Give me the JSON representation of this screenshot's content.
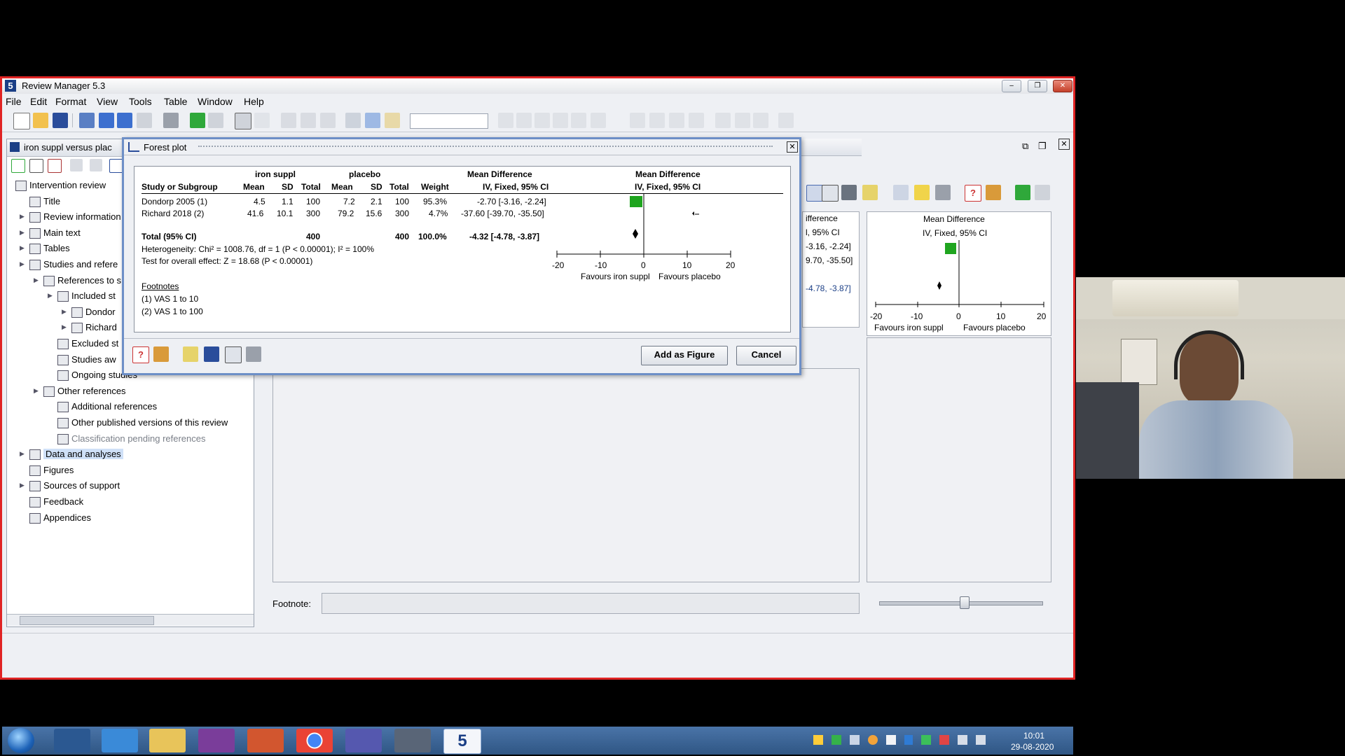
{
  "window": {
    "title": "Review Manager 5.3",
    "app_icon": "5"
  },
  "menu": [
    "File",
    "Edit",
    "Format",
    "View",
    "Tools",
    "Table",
    "Window",
    "Help"
  ],
  "left_panel": {
    "tab_title": "iron suppl versus plac",
    "tree": [
      {
        "label": "Intervention review",
        "level": 0,
        "icon": "review-icon"
      },
      {
        "label": "Title",
        "level": 1,
        "icon": "title-icon"
      },
      {
        "label": "Review information",
        "level": 1,
        "icon": "info-icon",
        "expandable": true
      },
      {
        "label": "Main text",
        "level": 1,
        "icon": "text-icon",
        "expandable": true
      },
      {
        "label": "Tables",
        "level": 1,
        "icon": "table-icon",
        "expandable": true
      },
      {
        "label": "Studies and refere",
        "level": 1,
        "icon": "studies-icon",
        "expandable": true
      },
      {
        "label": "References to s",
        "level": 2,
        "icon": "refs-icon",
        "expandable": true
      },
      {
        "label": "Included st",
        "level": 3,
        "icon": "study-icon",
        "expandable": true
      },
      {
        "label": "Dondor",
        "level": 4,
        "icon": "study-icon",
        "expandable": true
      },
      {
        "label": "Richard",
        "level": 4,
        "icon": "study-icon",
        "expandable": true
      },
      {
        "label": "Excluded st",
        "level": 3,
        "icon": "study-icon"
      },
      {
        "label": "Studies aw",
        "level": 3,
        "icon": "study-icon"
      },
      {
        "label": "Ongoing studies",
        "level": 3,
        "icon": "study-icon"
      },
      {
        "label": "Other references",
        "level": 2,
        "icon": "refs-icon",
        "expandable": true
      },
      {
        "label": "Additional references",
        "level": 3,
        "icon": "refs-icon"
      },
      {
        "label": "Other published versions of this review",
        "level": 3,
        "icon": "refs-icon"
      },
      {
        "label": "Classification pending references",
        "level": 3,
        "icon": "refs-icon",
        "dim": true
      },
      {
        "label": "Data and analyses",
        "level": 1,
        "icon": "analysis-icon",
        "expandable": true,
        "selected": true
      },
      {
        "label": "Figures",
        "level": 1,
        "icon": "figure-icon"
      },
      {
        "label": "Sources of support",
        "level": 1,
        "icon": "support-icon",
        "expandable": true
      },
      {
        "label": "Feedback",
        "level": 1,
        "icon": "feedback-icon"
      },
      {
        "label": "Appendices",
        "level": 1,
        "icon": "appendix-icon"
      }
    ]
  },
  "right_panel": {
    "col_header_partial": "ifference",
    "col_sub_partial": "l, 95% CI",
    "row1_partial": "-3.16, -2.24]",
    "row2_partial": "9.70, -35.50]",
    "total_partial": "-4.78, -3.87]",
    "md_header": "Mean Difference",
    "md_sub": "IV, Fixed, 95% CI",
    "axis_ticks": [
      "-20",
      "-10",
      "0",
      "10",
      "20"
    ],
    "favours_left": "Favours iron suppl",
    "favours_right": "Favours placebo"
  },
  "footnote_label": "Footnote:",
  "dialog": {
    "title": "Forest plot",
    "group_exp": "iron suppl",
    "group_ctrl": "placebo",
    "md_header": "Mean Difference",
    "md_sub": "IV, Fixed, 95% CI",
    "col_study": "Study or Subgroup",
    "col_mean": "Mean",
    "col_sd": "SD",
    "col_total": "Total",
    "col_weight": "Weight",
    "rows": [
      {
        "study": "Dondorp 2005 (1)",
        "m1": "4.5",
        "sd1": "1.1",
        "n1": "100",
        "m2": "7.2",
        "sd2": "2.1",
        "n2": "100",
        "w": "95.3%",
        "ci": "-2.70 [-3.16, -2.24]"
      },
      {
        "study": "Richard 2018 (2)",
        "m1": "41.6",
        "sd1": "10.1",
        "n1": "300",
        "m2": "79.2",
        "sd2": "15.6",
        "n2": "300",
        "w": "4.7%",
        "ci": "-37.60 [-39.70, -35.50]"
      }
    ],
    "total": {
      "label": "Total (95% CI)",
      "n1": "400",
      "n2": "400",
      "w": "100.0%",
      "ci": "-4.32 [-4.78, -3.87]"
    },
    "heterogeneity": "Heterogeneity: Chi² = 1008.76, df = 1 (P < 0.00001); I² = 100%",
    "overall": "Test for overall effect: Z = 18.68 (P < 0.00001)",
    "footnotes_title": "Footnotes",
    "footnotes": [
      "(1) VAS 1 to 10",
      "(2) VAS 1 to 100"
    ],
    "axis_ticks": [
      "-20",
      "-10",
      "0",
      "10",
      "20"
    ],
    "favours_left": "Favours iron suppl",
    "favours_right": "Favours placebo",
    "add_button": "Add as Figure",
    "cancel_button": "Cancel"
  },
  "taskbar": {
    "time": "10:01",
    "date": "29-08-2020",
    "apps": [
      "windows-start",
      "task-manager",
      "internet-explorer",
      "file-explorer",
      "onenote",
      "powerpoint",
      "chrome",
      "teams",
      "review-tool",
      "review-manager"
    ]
  },
  "colors": {
    "accent_border": "#e02424",
    "square": "#1fa51f",
    "dialog_border": "#6d8fc7"
  }
}
